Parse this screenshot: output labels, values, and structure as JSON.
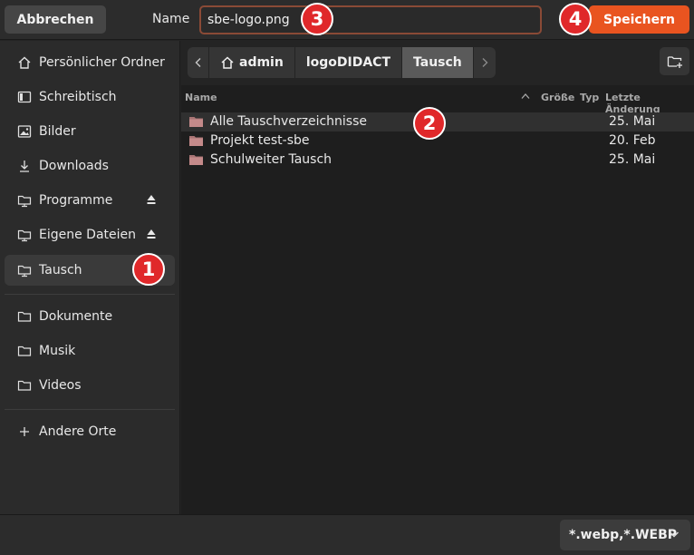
{
  "header": {
    "cancel_label": "Abbrechen",
    "name_label": "Name",
    "filename_value": "sbe-logo.png",
    "save_label": "Speichern"
  },
  "sidebar": {
    "items": [
      {
        "label": "Persönlicher Ordner",
        "icon": "home-icon"
      },
      {
        "label": "Schreibtisch",
        "icon": "desktop-icon"
      },
      {
        "label": "Bilder",
        "icon": "image-icon"
      },
      {
        "label": "Downloads",
        "icon": "download-icon"
      },
      {
        "label": "Programme",
        "icon": "network-folder-icon"
      },
      {
        "label": "Eigene Dateien",
        "icon": "network-folder-icon"
      },
      {
        "label": "Tausch",
        "icon": "network-folder-icon"
      },
      {
        "label": "Dokumente",
        "icon": "folder-icon"
      },
      {
        "label": "Musik",
        "icon": "folder-icon"
      },
      {
        "label": "Videos",
        "icon": "folder-icon"
      },
      {
        "label": "Andere Orte",
        "icon": "plus-icon"
      }
    ]
  },
  "pathbar": {
    "crumbs": [
      "admin",
      "logoDIDACT",
      "Tausch"
    ]
  },
  "list": {
    "columns": {
      "name": "Name",
      "size": "Größe",
      "type": "Typ",
      "modified": "Letzte Änderung"
    },
    "rows": [
      {
        "name": "Alle Tauschverzeichnisse",
        "date": "25. Mai"
      },
      {
        "name": "Projekt test-sbe",
        "date": "20. Feb"
      },
      {
        "name": "Schulweiter Tausch",
        "date": "25. Mai"
      }
    ]
  },
  "footer": {
    "filter_value": "*.webp,*.WEBP"
  },
  "markers": [
    "1",
    "2",
    "3",
    "4"
  ],
  "colors": {
    "accent": "#e95420",
    "marker": "#e0282a",
    "folder": "#b07a7a"
  }
}
